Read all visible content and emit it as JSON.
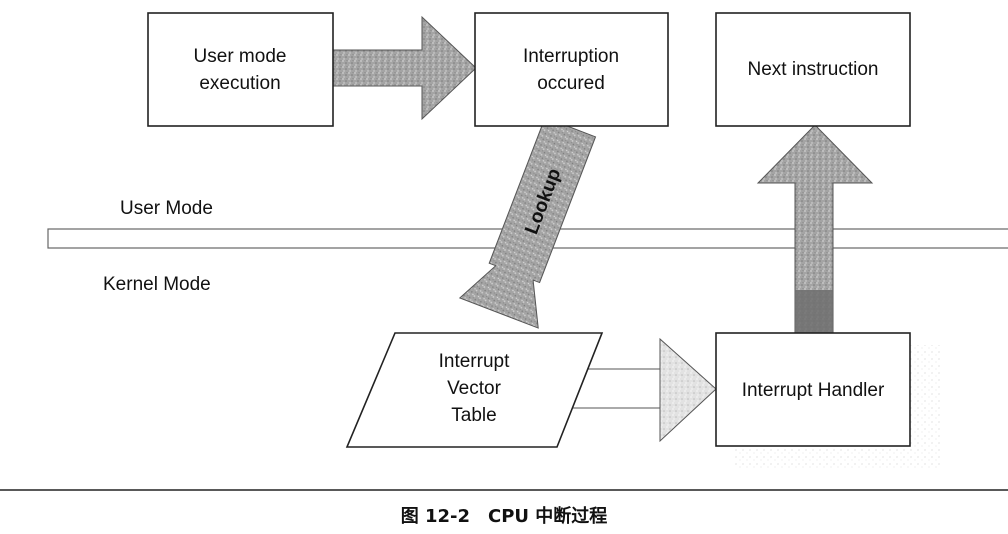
{
  "diagram": {
    "boxes": {
      "user_mode_execution": [
        "User mode",
        "execution"
      ],
      "interruption_occured": [
        "Interruption",
        "occured"
      ],
      "next_instruction": [
        "Next instruction"
      ],
      "interrupt_vector_table": [
        "Interrupt",
        "Vector",
        "Table"
      ],
      "interrupt_handler": [
        "Interrupt Handler"
      ]
    },
    "labels": {
      "user_mode": "User Mode",
      "kernel_mode": "Kernel Mode",
      "lookup": "Lookup"
    },
    "caption": "图 12-2　CPU 中断过程",
    "colors": {
      "arrow_fill": "#9a9a9a",
      "arrow_dark": "#6e6e6e",
      "arrow_light": "#d6d6d6",
      "box_stroke": "#222222"
    }
  }
}
